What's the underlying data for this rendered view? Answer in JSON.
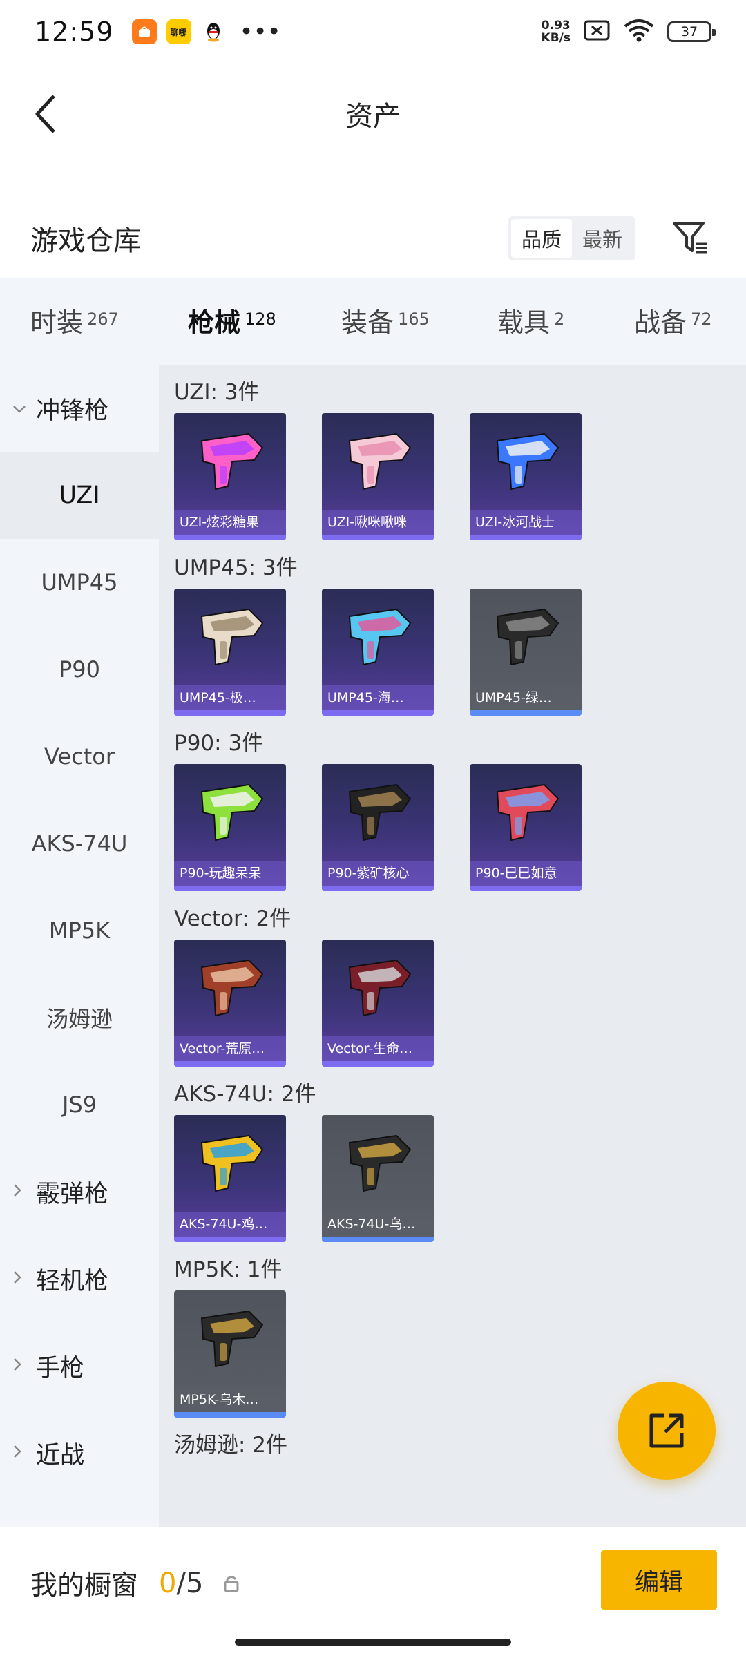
{
  "status_bar": {
    "time": "12:59",
    "apps": [
      {
        "icon": "taobao-icon",
        "color": "#ff7a1a",
        "text": ""
      },
      {
        "icon": "meituan-icon",
        "color": "#ffcc00",
        "text": "聊哪"
      },
      {
        "icon": "qq-penguin-icon",
        "color": "#ffffff",
        "text": ""
      }
    ],
    "more": "•••",
    "net_speed_value": "0.93",
    "net_speed_unit": "KB/s",
    "battery": "37"
  },
  "header": {
    "title": "资产",
    "back_icon": "back-chevron-icon"
  },
  "warehouse": {
    "title": "游戏仓库",
    "sort_options": [
      {
        "label": "品质",
        "active": true
      },
      {
        "label": "最新",
        "active": false
      }
    ],
    "filter_icon": "filter-icon"
  },
  "tabs": [
    {
      "label": "时装",
      "count": "267",
      "active": false
    },
    {
      "label": "枪械",
      "count": "128",
      "active": true
    },
    {
      "label": "装备",
      "count": "165",
      "active": false
    },
    {
      "label": "载具",
      "count": "2",
      "active": false
    },
    {
      "label": "战备",
      "count": "72",
      "active": false
    }
  ],
  "sidebar": {
    "group_open": "冲锋枪",
    "items": [
      "UZI",
      "UMP45",
      "P90",
      "Vector",
      "AKS-74U",
      "MP5K",
      "汤姆逊",
      "JS9"
    ],
    "active_item": "UZI",
    "groups_collapsed": [
      "霰弹枪",
      "轻机枪",
      "手枪",
      "近战"
    ]
  },
  "sections": [
    {
      "title": "UZI: 3件",
      "items": [
        {
          "name": "UZI-炫彩糖果",
          "tier": "purple",
          "art": "pink"
        },
        {
          "name": "UZI-啾咪啾咪",
          "tier": "purple",
          "art": "blush"
        },
        {
          "name": "UZI-冰河战士",
          "tier": "purple",
          "art": "blue"
        }
      ]
    },
    {
      "title": "UMP45: 3件",
      "items": [
        {
          "name": "UMP45-极…",
          "tier": "purple",
          "art": "cream"
        },
        {
          "name": "UMP45-海…",
          "tier": "purple",
          "art": "cyan"
        },
        {
          "name": "UMP45-绿…",
          "tier": "grey",
          "art": "dark"
        }
      ]
    },
    {
      "title": "P90: 3件",
      "items": [
        {
          "name": "P90-玩趣呆呆",
          "tier": "purple",
          "art": "green"
        },
        {
          "name": "P90-紫矿核心",
          "tier": "purple",
          "art": "black"
        },
        {
          "name": "P90-巳巳如意",
          "tier": "purple",
          "art": "redblue"
        }
      ]
    },
    {
      "title": "Vector: 2件",
      "items": [
        {
          "name": "Vector-荒原…",
          "tier": "purple",
          "art": "rust"
        },
        {
          "name": "Vector-生命…",
          "tier": "purple",
          "art": "crimson"
        }
      ]
    },
    {
      "title": "AKS-74U: 2件",
      "items": [
        {
          "name": "AKS-74U-鸡…",
          "tier": "purple",
          "art": "yellowblue"
        },
        {
          "name": "AKS-74U-乌…",
          "tier": "grey",
          "art": "gold"
        }
      ]
    },
    {
      "title": "MP5K: 1件",
      "items": [
        {
          "name": "MP5K-乌木…",
          "tier": "grey",
          "art": "gold"
        }
      ]
    },
    {
      "title": "汤姆逊: 2件",
      "items": []
    }
  ],
  "fab_icon": "share-external-icon",
  "bottom_bar": {
    "label": "我的橱窗",
    "count": "0",
    "separator": "/",
    "max": "5",
    "lock_icon": "lock-icon",
    "edit_label": "编辑"
  },
  "colors": {
    "accent": "#f7b500",
    "purple_tier": "#7d6cf0",
    "grey_tier": "#5b8cf5"
  }
}
